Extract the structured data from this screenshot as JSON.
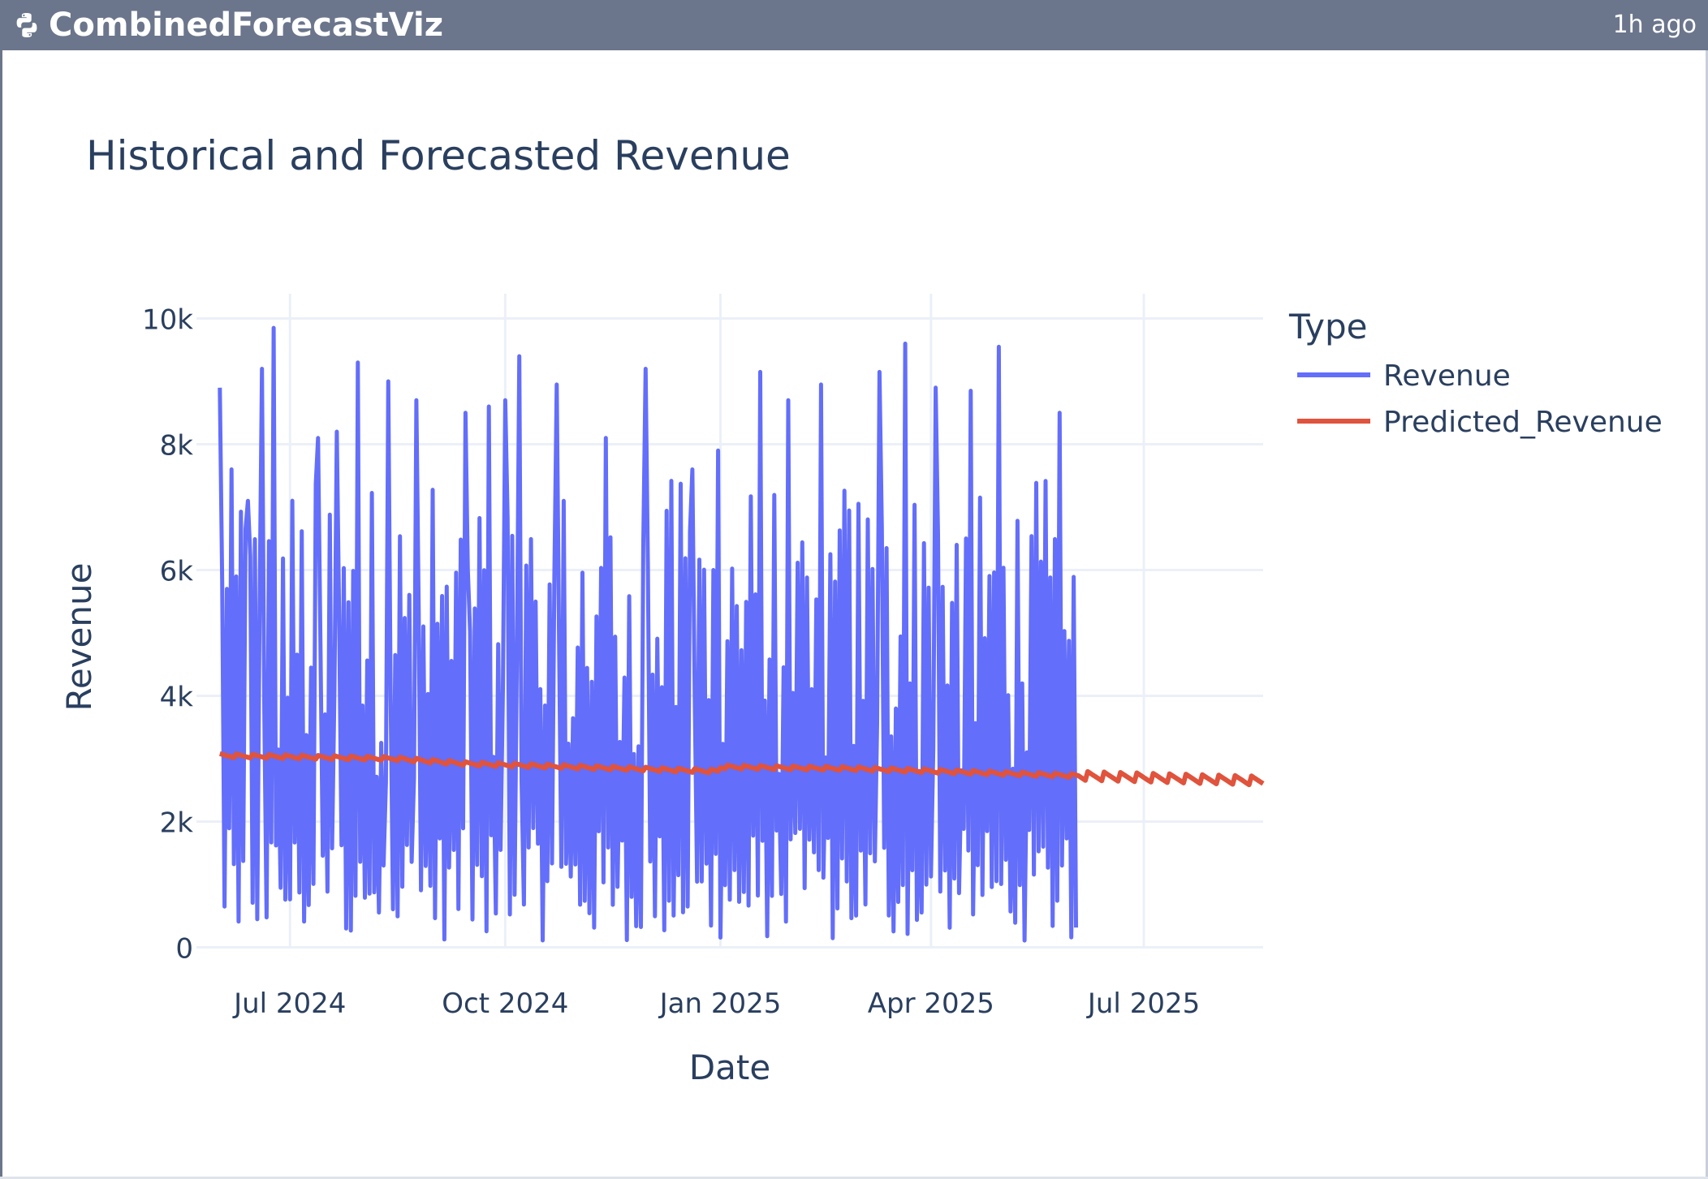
{
  "panel": {
    "title": "CombinedForecastViz",
    "updated": "1h ago",
    "icon": "python-icon"
  },
  "colors": {
    "header_bg": "#6b768c",
    "revenue": "#636efa",
    "predicted": "#e0533c",
    "grid": "#ebf0f8",
    "text": "#2a3f5f"
  },
  "chart_data": {
    "type": "line",
    "title": "Historical and Forecasted Revenue",
    "xlabel": "Date",
    "ylabel": "Revenue",
    "x_range": [
      "2024-05-22",
      "2025-08-21"
    ],
    "ylim": [
      0,
      10400
    ],
    "x_ticks": [
      {
        "date": "2024-07-01",
        "label": "Jul 2024"
      },
      {
        "date": "2024-10-01",
        "label": "Oct 2024"
      },
      {
        "date": "2025-01-01",
        "label": "Jan 2025"
      },
      {
        "date": "2025-04-01",
        "label": "Apr 2025"
      },
      {
        "date": "2025-07-01",
        "label": "Jul 2025"
      }
    ],
    "y_ticks": [
      {
        "value": 0,
        "label": "0"
      },
      {
        "value": 2000,
        "label": "2k"
      },
      {
        "value": 4000,
        "label": "4k"
      },
      {
        "value": 6000,
        "label": "6k"
      },
      {
        "value": 8000,
        "label": "8k"
      },
      {
        "value": 10000,
        "label": "10k"
      }
    ],
    "grid": true,
    "legend": {
      "title": "Type",
      "position": "top-right"
    },
    "series": [
      {
        "name": "Revenue",
        "start_date": "2024-06-01",
        "end_date": "2025-06-02",
        "peaks": [
          {
            "date": "2024-06-01",
            "value": 8900
          },
          {
            "date": "2024-06-06",
            "value": 7600
          },
          {
            "date": "2024-06-13",
            "value": 7100
          },
          {
            "date": "2024-06-19",
            "value": 9200
          },
          {
            "date": "2024-06-24",
            "value": 9850
          },
          {
            "date": "2024-07-13",
            "value": 8100
          },
          {
            "date": "2024-07-21",
            "value": 8200
          },
          {
            "date": "2024-07-30",
            "value": 9300
          },
          {
            "date": "2024-08-12",
            "value": 9000
          },
          {
            "date": "2024-08-24",
            "value": 8700
          },
          {
            "date": "2024-09-14",
            "value": 8500
          },
          {
            "date": "2024-09-24",
            "value": 8600
          },
          {
            "date": "2024-10-01",
            "value": 8700
          },
          {
            "date": "2024-10-07",
            "value": 9400
          },
          {
            "date": "2024-10-23",
            "value": 8950
          },
          {
            "date": "2024-11-13",
            "value": 8100
          },
          {
            "date": "2024-11-30",
            "value": 9200
          },
          {
            "date": "2024-12-20",
            "value": 7600
          },
          {
            "date": "2024-12-31",
            "value": 7900
          },
          {
            "date": "2025-01-18",
            "value": 9150
          },
          {
            "date": "2025-01-30",
            "value": 8700
          },
          {
            "date": "2025-02-13",
            "value": 8950
          },
          {
            "date": "2025-03-10",
            "value": 9150
          },
          {
            "date": "2025-03-21",
            "value": 9600
          },
          {
            "date": "2025-04-03",
            "value": 8900
          },
          {
            "date": "2025-04-18",
            "value": 8850
          },
          {
            "date": "2025-04-30",
            "value": 9550
          },
          {
            "date": "2025-05-26",
            "value": 8500
          }
        ],
        "band": {
          "low": 100,
          "high": 5300
        },
        "gaps": [
          "2024-09-15",
          "2024-12-29"
        ]
      },
      {
        "name": "Predicted_Revenue",
        "points": [
          {
            "date": "2024-06-01",
            "value": 3050
          },
          {
            "date": "2024-08-15",
            "value": 3000
          },
          {
            "date": "2024-09-15",
            "value": 2920
          },
          {
            "date": "2024-12-31",
            "value": 2800
          },
          {
            "date": "2025-01-01",
            "value": 2870
          },
          {
            "date": "2025-03-01",
            "value": 2840
          },
          {
            "date": "2025-06-02",
            "value": 2730
          },
          {
            "date": "2025-08-21",
            "value": 2650
          }
        ]
      }
    ]
  }
}
